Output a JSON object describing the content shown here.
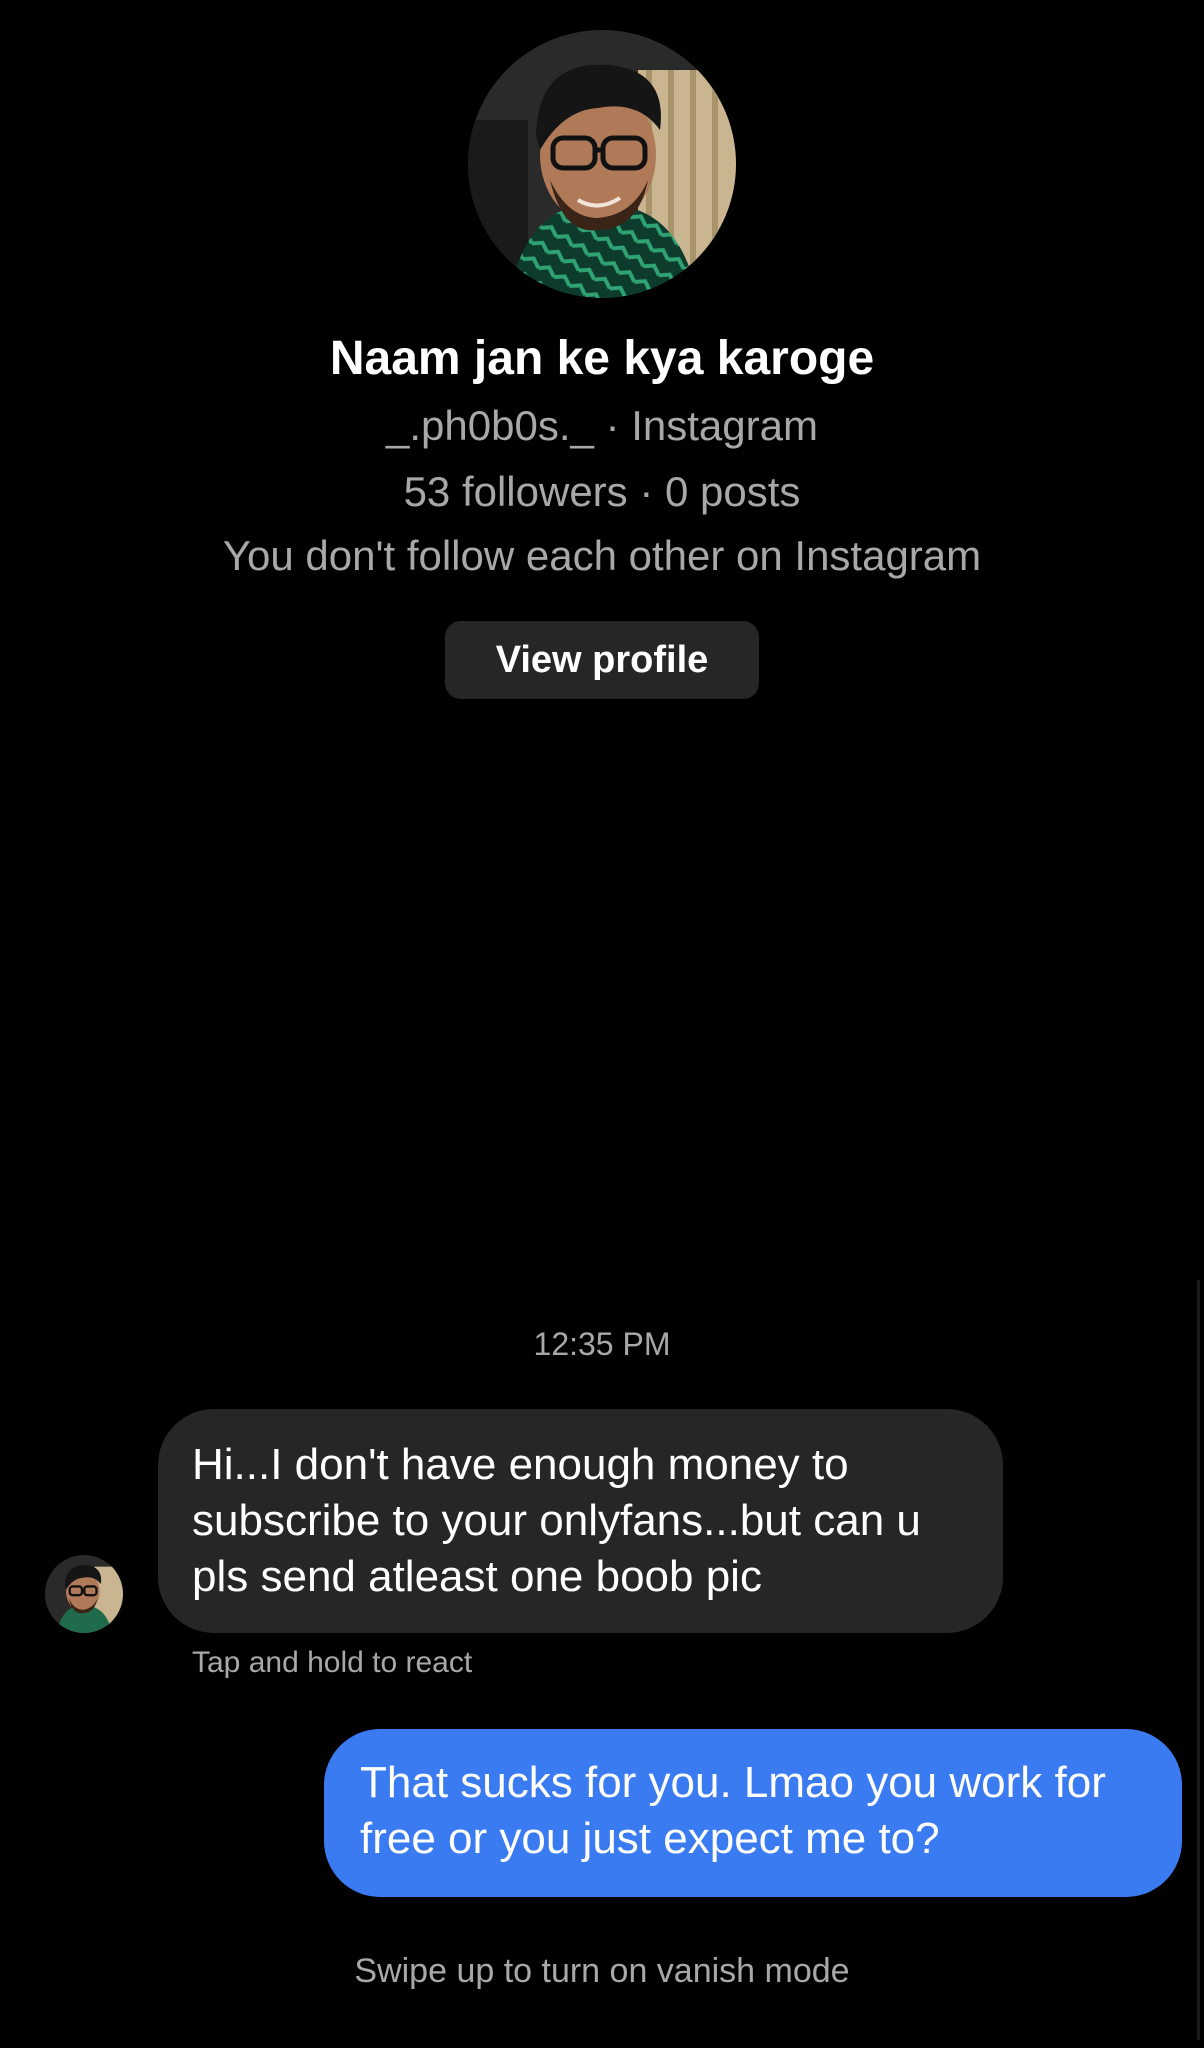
{
  "profile": {
    "avatar_icon": "profile-photo",
    "name": "Naam jan ke kya karoge",
    "handle_line": "_.ph0b0s._ · Instagram",
    "stats_line": "53 followers · 0 posts",
    "follow_status": "You don't follow each other on Instagram",
    "view_profile_label": "View profile"
  },
  "conversation": {
    "timestamp": "12:35 PM",
    "messages": [
      {
        "direction": "incoming",
        "text": "Hi...I don't have enough money to\nsubscribe to your onlyfans...but can u\npls send atleast one boob pic"
      },
      {
        "direction": "outgoing",
        "text": "That sucks for you. Lmao you work for\nfree or you just expect me to?"
      }
    ],
    "react_hint": "Tap and hold to react",
    "vanish_hint": "Swipe up to turn on vanish mode"
  },
  "colors": {
    "background": "#000000",
    "incoming_bubble": "#262626",
    "outgoing_bubble": "#3b7bf2",
    "secondary_text": "#a8a8a8"
  }
}
